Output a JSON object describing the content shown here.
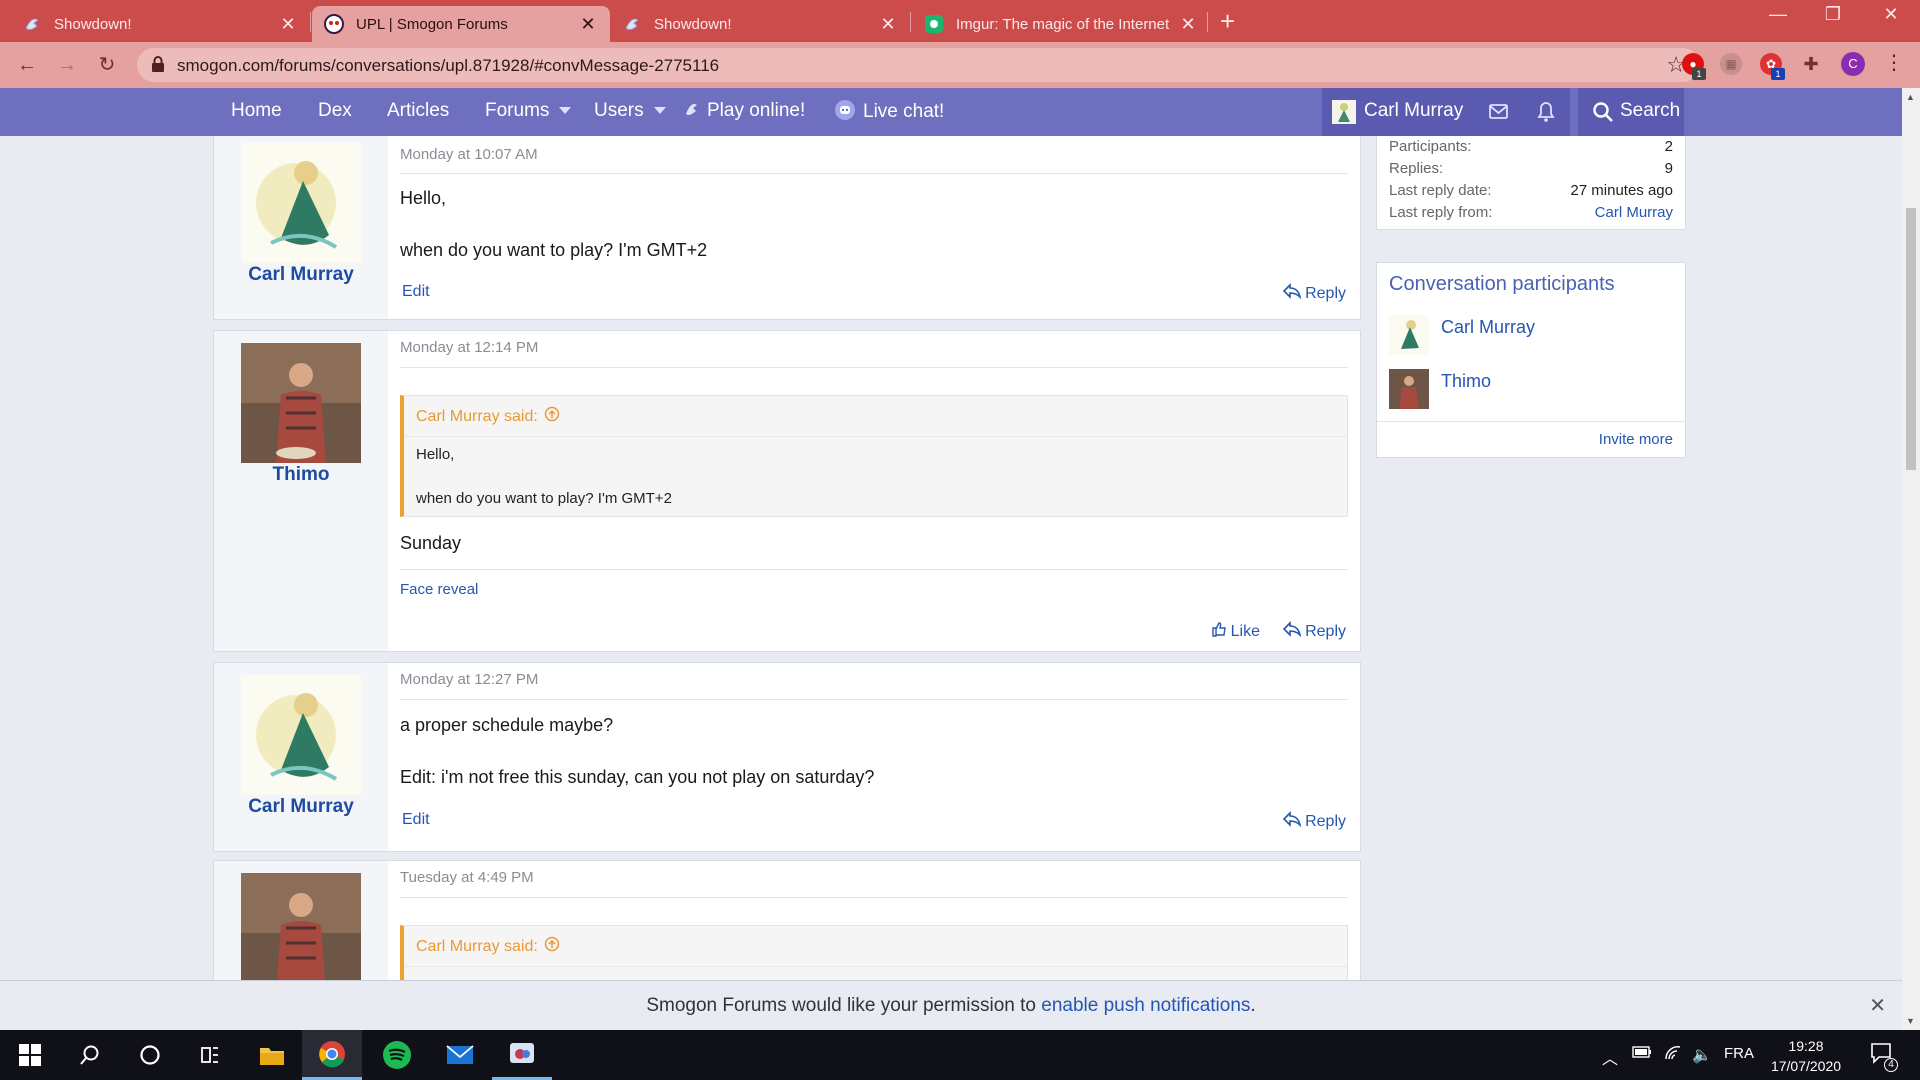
{
  "browser": {
    "tabs": [
      {
        "title": "Showdown!",
        "active": false
      },
      {
        "title": "UPL | Smogon Forums",
        "active": true
      },
      {
        "title": "Showdown!",
        "active": false
      },
      {
        "title": "Imgur: The magic of the Internet",
        "active": false
      }
    ],
    "url": "smogon.com/forums/conversations/upl.871928/#convMessage-2775116",
    "profile_initial": "C",
    "ext_badge": "1"
  },
  "nav": {
    "links": [
      "Home",
      "Dex",
      "Articles",
      "Forums",
      "Users",
      "Play online!",
      "Live chat!"
    ],
    "user": "Carl Murray",
    "search": "Search"
  },
  "messages": [
    {
      "author": "Carl Murray",
      "date": "Monday at 10:07 AM",
      "lines": [
        "Hello,",
        "when do you want to play? I'm GMT+2"
      ],
      "edit": "Edit",
      "reply": "Reply"
    },
    {
      "author": "Thimo",
      "date": "Monday at 12:14 PM",
      "quote": {
        "head": "Carl Murray said:",
        "lines": [
          "Hello,",
          "when do you want to play? I'm GMT+2"
        ]
      },
      "lines": [
        "Sunday"
      ],
      "signature": "Face reveal",
      "like": "Like",
      "reply": "Reply"
    },
    {
      "author": "Carl Murray",
      "date": "Monday at 12:27 PM",
      "lines": [
        "a proper schedule maybe?",
        "Edit: i'm not free this sunday, can you not play on saturday?"
      ],
      "edit": "Edit",
      "reply": "Reply"
    },
    {
      "author": "",
      "date": "Tuesday at 4:49 PM",
      "quote": {
        "head": "Carl Murray said:"
      }
    }
  ],
  "sidebar": {
    "stats": [
      {
        "label": "Participants:",
        "value": "2"
      },
      {
        "label": "Replies:",
        "value": "9"
      },
      {
        "label": "Last reply date:",
        "value": "27 minutes ago"
      },
      {
        "label": "Last reply from:",
        "value": "Carl Murray"
      }
    ],
    "participants_title": "Conversation participants",
    "participants": [
      "Carl Murray",
      "Thimo"
    ],
    "invite": "Invite more"
  },
  "push": {
    "before": "Smogon Forums would like your permission to ",
    "link": "enable push notifications",
    "after": "."
  },
  "taskbar": {
    "language": "FRA",
    "time": "19:28",
    "date": "17/07/2020",
    "notifications": "4"
  },
  "colors": {
    "tabbar": "#cc4b4b",
    "nav": "#6e6fbf",
    "link": "#2456b3",
    "quote_accent": "#f0a030"
  }
}
